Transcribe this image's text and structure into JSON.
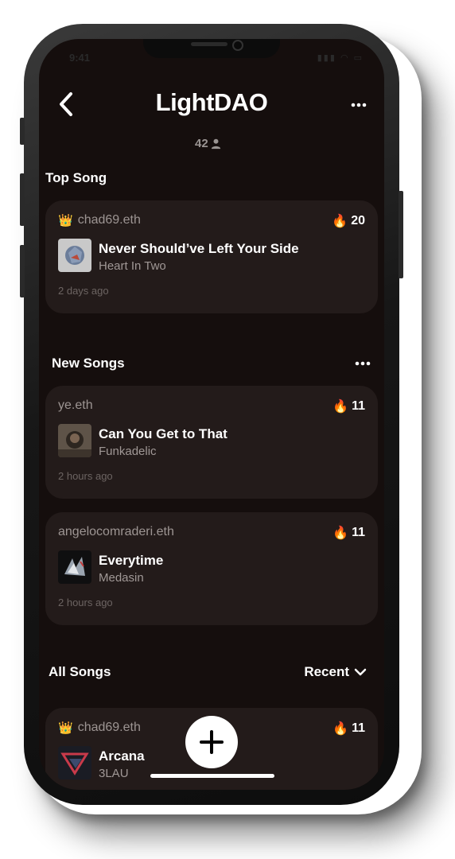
{
  "status_bar": {
    "time": "9:41"
  },
  "header": {
    "title": "LightDAO",
    "member_count": "42"
  },
  "top_song": {
    "section_title": "Top Song",
    "card": {
      "user": "chad69.eth",
      "likes": "20",
      "song": "Never Should’ve Left Your Side",
      "artist": "Heart In Two",
      "time": "2 days ago"
    }
  },
  "new_songs": {
    "section_title": "New Songs",
    "cards": [
      {
        "user": "ye.eth",
        "likes": "11",
        "song": "Can You Get to That",
        "artist": "Funkadelic",
        "time": "2 hours ago"
      },
      {
        "user": "angelocomraderi.eth",
        "likes": "11",
        "song": "Everytime",
        "artist": "Medasin",
        "time": "2 hours ago"
      }
    ]
  },
  "all_songs": {
    "section_title": "All Songs",
    "sort_label": "Recent",
    "card": {
      "user": "chad69.eth",
      "likes": "11",
      "song": "Arcana",
      "artist": "3LAU"
    }
  },
  "icons": {
    "crown": "crown-icon",
    "fire": "fire-icon",
    "back": "back-chevron-icon",
    "more": "more-horizontal-icon",
    "person": "person-icon",
    "add": "plus-icon"
  }
}
